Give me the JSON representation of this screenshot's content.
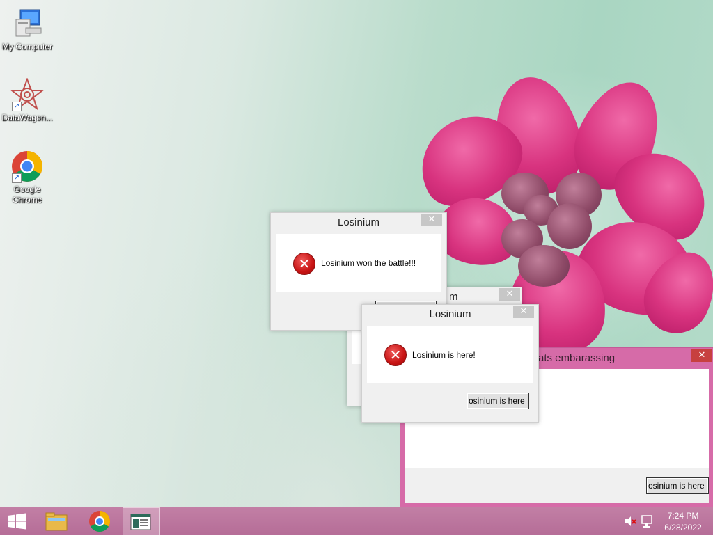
{
  "desktop": {
    "icons": [
      {
        "label": "My Computer",
        "icon": "my-computer-icon"
      },
      {
        "label": "DataWagon...",
        "icon": "datawagon-icon"
      },
      {
        "label": "Google Chrome",
        "icon": "chrome-icon"
      }
    ]
  },
  "dialogs": {
    "front": {
      "title": "Losinium",
      "message": "Losinium is here!",
      "button": "osinium is here",
      "close": "✕"
    },
    "top": {
      "title": "Losinium",
      "message": "Losinium won the battle!!!",
      "close": "✕"
    },
    "hidden": {
      "title_fragment": "m",
      "close": "✕"
    }
  },
  "pink_window": {
    "title_fragment": "ats embarassing",
    "button": "osinium is here",
    "close": "✕"
  },
  "taskbar": {
    "items": [
      "start-button",
      "file-explorer-icon",
      "chrome-icon",
      "active-app-icon"
    ],
    "clock": {
      "time": "7:24 PM",
      "date": "6/28/2022"
    }
  },
  "colors": {
    "taskbar": "#b56d97",
    "pink_window": "#d66ba8",
    "close_red": "#c7403f",
    "error_red": "#c81414"
  }
}
